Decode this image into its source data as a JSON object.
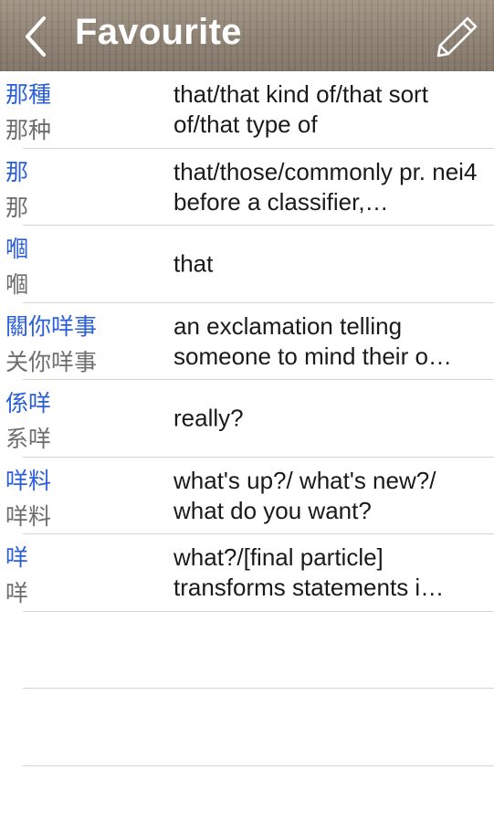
{
  "navbar": {
    "title": "Favourite",
    "back_icon": "chevron-left-icon",
    "edit_icon": "pencil-icon"
  },
  "entries": [
    {
      "traditional": "那種",
      "simplified": "那种",
      "definition": "that/that kind of/that sort of/that type of"
    },
    {
      "traditional": "那",
      "simplified": "那",
      "definition": "that/those/commonly pr. nei4 before a classifier,…"
    },
    {
      "traditional": "嗰",
      "simplified": "嗰",
      "definition": "that"
    },
    {
      "traditional": "關你咩事",
      "simplified": "关你咩事",
      "definition": "an exclamation telling someone to mind their o…"
    },
    {
      "traditional": "係咩",
      "simplified": "系咩",
      "definition": "really?"
    },
    {
      "traditional": "咩料",
      "simplified": "咩料",
      "definition": "what's up?/ what's new?/ what do you want?"
    },
    {
      "traditional": "咩",
      "simplified": "咩",
      "definition": "what?/[final particle] transforms statements i…"
    }
  ],
  "colors": {
    "traditional_text": "#2b5fd8",
    "simplified_text": "#6e6e6e",
    "separator": "#d4d4d4"
  }
}
